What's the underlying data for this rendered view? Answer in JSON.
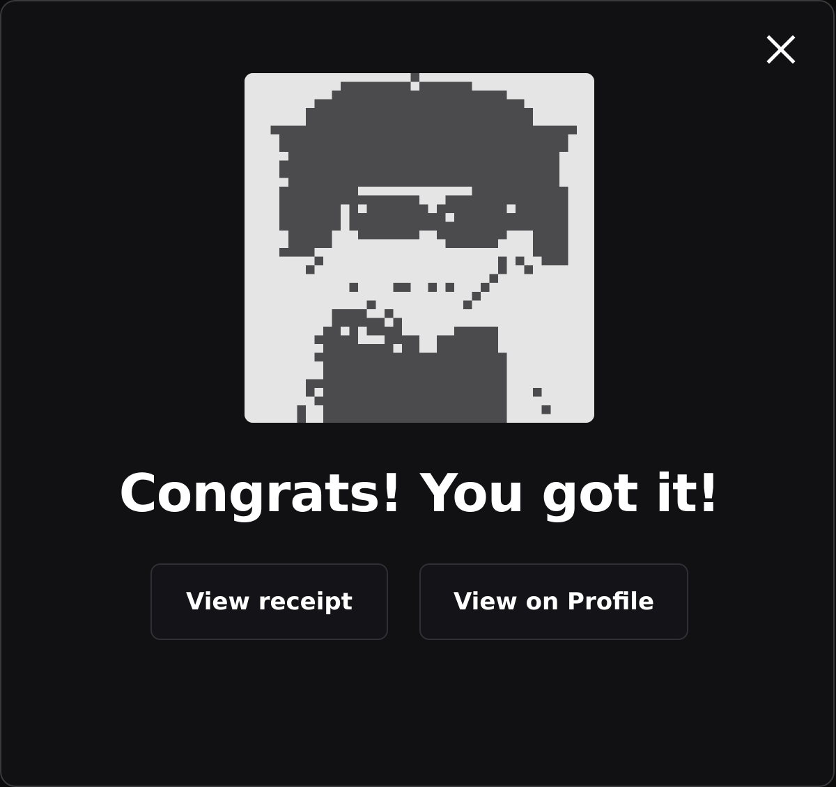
{
  "modal": {
    "title": "Congrats! You got it!",
    "close_icon": "close-icon",
    "artwork_icon": "pixel-portrait-image",
    "buttons": {
      "view_receipt": "View receipt",
      "view_on_profile": "View on Profile"
    }
  },
  "colors": {
    "background": "#111113",
    "border": "#3a3a3d",
    "button_background": "#141418",
    "button_border": "#2f2f35",
    "text": "#ffffff",
    "art_light": "#e4e5e4",
    "art_dark": "#4b4b4e"
  }
}
